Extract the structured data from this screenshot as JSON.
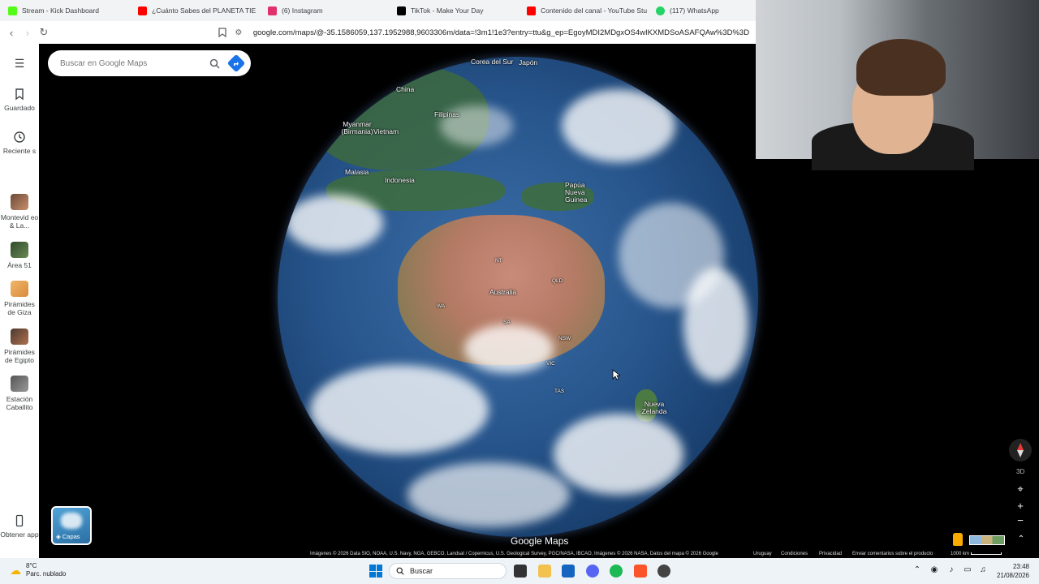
{
  "browser": {
    "tabs": [
      {
        "title": "Stream - Kick Dashboard",
        "favicon_color": "#53fc18"
      },
      {
        "title": "¿Cuánto Sabes del PLANETA TIE",
        "favicon_color": "#ff0000"
      },
      {
        "title": "(6) Instagram",
        "favicon_color": "#e1306c"
      },
      {
        "title": "TikTok - Make Your Day",
        "favicon_color": "#000000"
      },
      {
        "title": "Contenido del canal - YouTube Stu",
        "favicon_color": "#ff0000"
      },
      {
        "title": "(117) WhatsApp",
        "favicon_color": "#25d366"
      }
    ],
    "url": "google.com/maps/@-35.1586059,137.1952988,9603306m/data=!3m1!1e3?entry=ttu&g_ep=EgoyMDI2MDgxOS4wIKXMDSoASAFQAw%3D%3D"
  },
  "maps": {
    "search_placeholder": "Buscar en Google Maps",
    "rail": [
      {
        "label": "Guardado"
      },
      {
        "label": "Reciente s"
      },
      {
        "label": "Montevid eo & La..."
      },
      {
        "label": "Área 51"
      },
      {
        "label": "Pirámides de Giza"
      },
      {
        "label": "Pirámides de Egipto"
      },
      {
        "label": "Estación Caballito"
      }
    ],
    "get_app_label": "Obtener app",
    "layers_label": "Capas",
    "brand": "Google Maps",
    "attribution": "Imágenes © 2026 Data SIO, NOAA, U.S. Navy, NGA, GEBCO, Landsat / Copernicus, U.S. Geological Survey, PGC/NASA, IBCAO, Imágenes © 2026 NASA, Datos del mapa © 2026 Google",
    "footer_links": [
      "Uruguay",
      "Condiciones",
      "Privacidad",
      "Enviar comentarios sobre el producto"
    ],
    "scale": "1000 km",
    "label_3d": "3D",
    "labels": {
      "corea": "Corea del Sur",
      "japon": "Japón",
      "china": "China",
      "filipinas": "Filipinas",
      "myanmar": "Myanmar (Birmania)",
      "vietnam": "Vietnam",
      "malasia": "Malasia",
      "indonesia": "Indonesia",
      "papua": "Papúa Nueva Guinea",
      "australia": "Australia",
      "nt": "NT",
      "qld": "QLD",
      "wa": "WA",
      "sa": "SA",
      "nsw": "NSW",
      "vic": "VIC",
      "tas": "TAS",
      "nz": "Nueva Zelanda"
    }
  },
  "taskbar": {
    "weather_temp": "8°C",
    "weather_desc": "Parc. nublado",
    "search_label": "Buscar",
    "time": "23:48",
    "date": "21/08/2026"
  }
}
